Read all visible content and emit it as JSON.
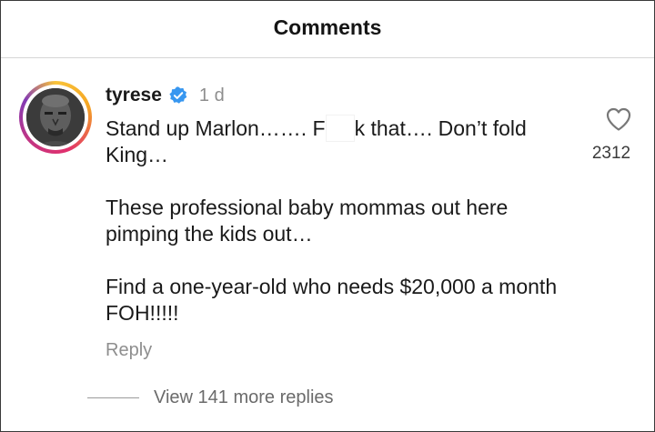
{
  "header": {
    "title": "Comments"
  },
  "comment": {
    "username": "tyrese",
    "verified_icon": "verified-badge-icon",
    "time": "1 d",
    "line1_part1": "Stand up Marlon……. F",
    "line1_part2": "k that…. Don’t fold King…",
    "paragraph2": "These professional baby mommas out here pimping the kids out…",
    "paragraph3": "Find a one-year-old who needs $20,000 a month  FOH!!!!!",
    "like_icon": "heart-outline-icon",
    "like_count": "2312",
    "reply_label": "Reply",
    "view_replies_label": "View 141 more replies"
  },
  "colors": {
    "verified_blue": "#3897f0",
    "muted_text": "#8e8e8e",
    "ring_gradient": [
      "#f9c43a",
      "#e1306c",
      "#833ab4"
    ]
  }
}
